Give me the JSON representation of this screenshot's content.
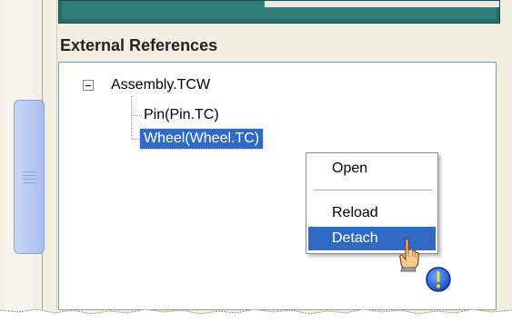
{
  "panel": {
    "title": "External References"
  },
  "tree": {
    "root": {
      "label": "Assembly.TCW",
      "expanded": true
    },
    "children": [
      {
        "label": "Pin(Pin.TC)",
        "selected": false
      },
      {
        "label": "Wheel(Wheel.TC)",
        "selected": true
      }
    ]
  },
  "context_menu": {
    "items": [
      {
        "label": "Open",
        "highlighted": false
      },
      {
        "label": "Reload",
        "highlighted": false
      },
      {
        "label": "Detach",
        "highlighted": true
      }
    ]
  },
  "colors": {
    "selection": "#316ac5",
    "top_panel": "#2a6b67",
    "chrome": "#f1efe2",
    "scroll_thumb": "#b7c9f2"
  },
  "icons": [
    "collapse-minus-icon",
    "hand-cursor-icon",
    "alert-exclamation-icon",
    "scrollbar-grip-icon"
  ]
}
